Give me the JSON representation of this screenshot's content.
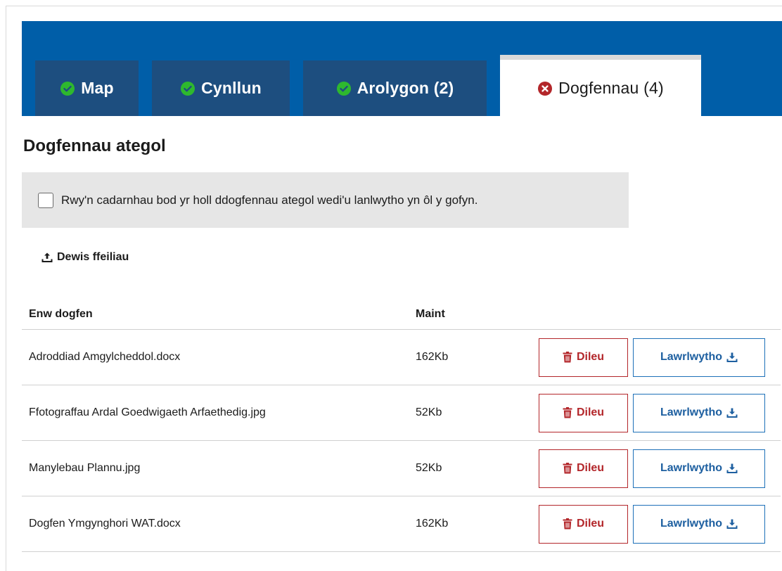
{
  "tabs": [
    {
      "label": "Map",
      "status": "complete",
      "icon": "check-circle-icon"
    },
    {
      "label": "Cynllun",
      "status": "complete",
      "icon": "check-circle-icon"
    },
    {
      "label": "Arolygon (2)",
      "status": "complete",
      "icon": "check-circle-icon"
    },
    {
      "label": "Dogfennau (4)",
      "status": "error",
      "icon": "error-circle-icon",
      "active": true
    }
  ],
  "section": {
    "title": "Dogfennau ategol",
    "confirm_label": "Rwy'n cadarnhau bod yr holl ddogfennau ategol wedi'u lanlwytho yn ôl y gofyn.",
    "confirm_checked": false,
    "choose_files_label": "Dewis ffeiliau"
  },
  "table": {
    "headers": {
      "name": "Enw dogfen",
      "size": "Maint"
    },
    "rows": [
      {
        "name": "Adroddiad Amgylcheddol.docx",
        "size": "162Kb"
      },
      {
        "name": "Ffotograffau Ardal Goedwigaeth Arfaethedig.jpg",
        "size": "52Kb"
      },
      {
        "name": "Manylebau Plannu.jpg",
        "size": "52Kb"
      },
      {
        "name": "Dogfen Ymgynghori WAT.docx",
        "size": "162Kb"
      }
    ],
    "delete_label": "Dileu",
    "download_label": "Lawrlwytho"
  },
  "colors": {
    "banner": "#005ea8",
    "tab": "#1d4e7f",
    "success": "#2eb82e",
    "error": "#b3262a",
    "link": "#1d70b8"
  }
}
